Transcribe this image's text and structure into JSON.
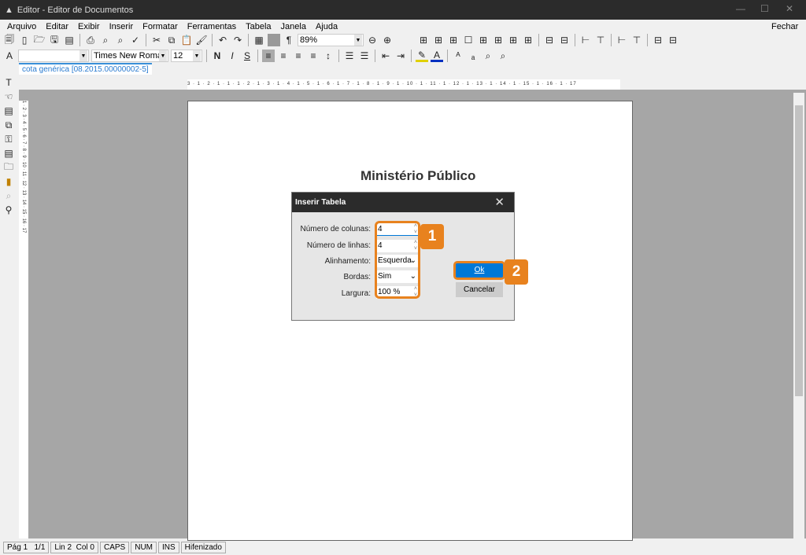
{
  "window": {
    "title": "Editor - Editor de Documentos",
    "close_doc": "Fechar"
  },
  "menu": [
    "Arquivo",
    "Editar",
    "Exibir",
    "Inserir",
    "Formatar",
    "Ferramentas",
    "Tabela",
    "Janela",
    "Ajuda"
  ],
  "toolbar": {
    "zoom": "89%",
    "style": "",
    "font": "Times New Roman",
    "size": "12",
    "bold": "N",
    "italic": "I",
    "underline": "S"
  },
  "tab": {
    "label": "cota genérica [08.2015.00000002-5]"
  },
  "ruler": "3 · 1 · 2 · 1 · 1 · 1 · 2 · 1 · 3 · 1 · 4 · 1 · 5 · 1 · 6 · 1 · 7 · 1 · 8 · 1 · 9 · 1 · 10 · 1 · 11 · 1 · 12 · 1 · 13 · 1 · 14 · 1 · 15 · 1 · 16 · 1 · 17",
  "vruler": "1 · 2 · 3 · 4 · 5 · 6 · 7 · 8 · 9 · 10 · 11 · 12 · 13 · 14 · 15 · 16 · 17",
  "document": {
    "header": "Ministério Público"
  },
  "dialog": {
    "title": "Inserir Tabela",
    "fields": [
      {
        "label": "Número de colunas:",
        "value": "4"
      },
      {
        "label": "Número de linhas:",
        "value": "4"
      },
      {
        "label": "Alinhamento:",
        "value": "Esquerda"
      },
      {
        "label": "Bordas:",
        "value": "Sim"
      },
      {
        "label": "Largura:",
        "value": "100 %"
      }
    ],
    "ok": "Ok",
    "cancel": "Cancelar",
    "badge1": "1",
    "badge2": "2"
  },
  "status": [
    "Pág 1",
    "1/1",
    "Lin 2  Col 0",
    "CAPS",
    "NUM",
    "INS",
    "Hifenizado"
  ],
  "colors": {
    "accent": "#0078d7",
    "highlight": "#e8821e",
    "titlebar": "#2b2b2b"
  }
}
